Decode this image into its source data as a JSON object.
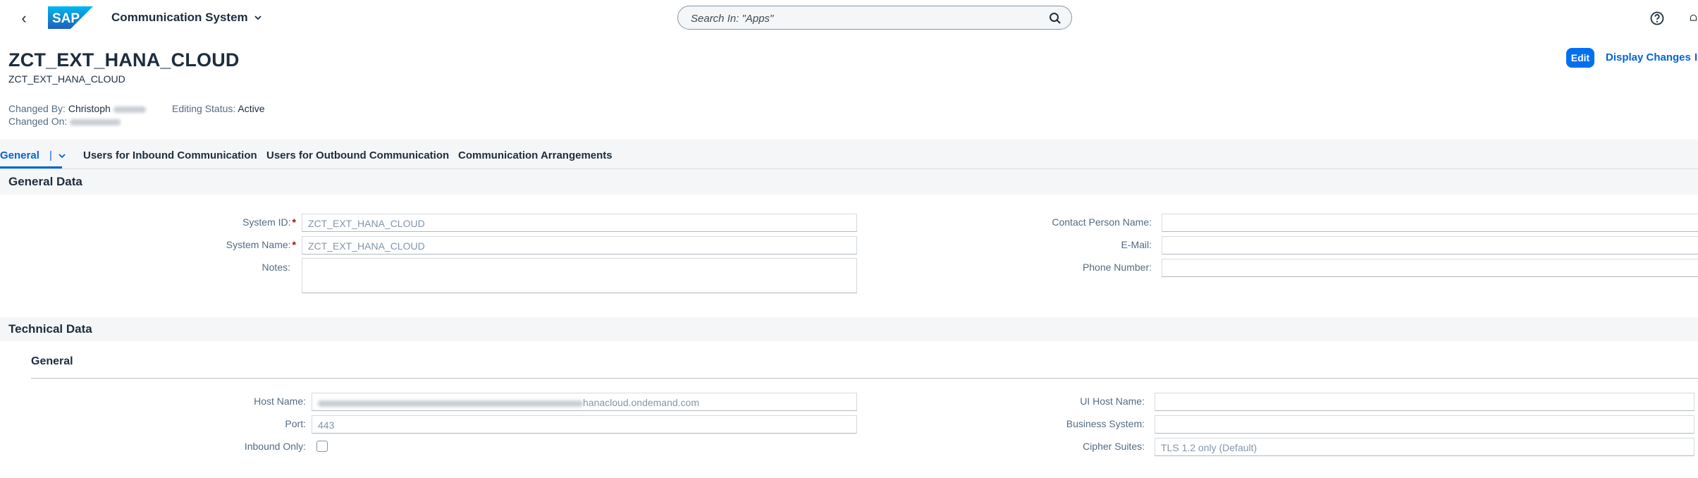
{
  "shell": {
    "logo_text": "SAP",
    "app_title": "Communication System",
    "search_placeholder": "Search In: \"Apps\""
  },
  "header": {
    "title": "ZCT_EXT_HANA_CLOUD",
    "subtitle": "ZCT_EXT_HANA_CLOUD",
    "changed_by_label": "Changed By:",
    "changed_by_value": "Christoph",
    "changed_on_label": "Changed On:",
    "editing_status_label": "Editing Status:",
    "editing_status_value": "Active",
    "edit_label": "Edit",
    "display_changes_label": "Display Changes"
  },
  "tabs": [
    {
      "label": "General"
    },
    {
      "label": "Users for Inbound Communication"
    },
    {
      "label": "Users for Outbound Communication"
    },
    {
      "label": "Communication Arrangements"
    }
  ],
  "general_data": {
    "title": "General Data",
    "system_id_label": "System ID:",
    "system_id_value": "ZCT_EXT_HANA_CLOUD",
    "system_name_label": "System Name:",
    "system_name_value": "ZCT_EXT_HANA_CLOUD",
    "notes_label": "Notes:",
    "notes_value": "",
    "contact_person_label": "Contact Person Name:",
    "contact_person_value": "",
    "email_label": "E-Mail:",
    "email_value": "",
    "phone_label": "Phone Number:",
    "phone_value": ""
  },
  "technical_data": {
    "title": "Technical Data",
    "sub_title": "General",
    "host_name_label": "Host Name:",
    "host_name_suffix": "hanacloud.ondemand.com",
    "port_label": "Port:",
    "port_value": "443",
    "inbound_only_label": "Inbound Only:",
    "inbound_only_checked": false,
    "ui_host_name_label": "UI Host Name:",
    "ui_host_name_value": "",
    "business_system_label": "Business System:",
    "business_system_value": "",
    "cipher_suites_label": "Cipher Suites:",
    "cipher_suites_value": "TLS 1.2 only (Default)"
  },
  "colors": {
    "brand_blue": "#0070f2",
    "link_blue": "#0064d9",
    "required_red": "#aa0808"
  }
}
